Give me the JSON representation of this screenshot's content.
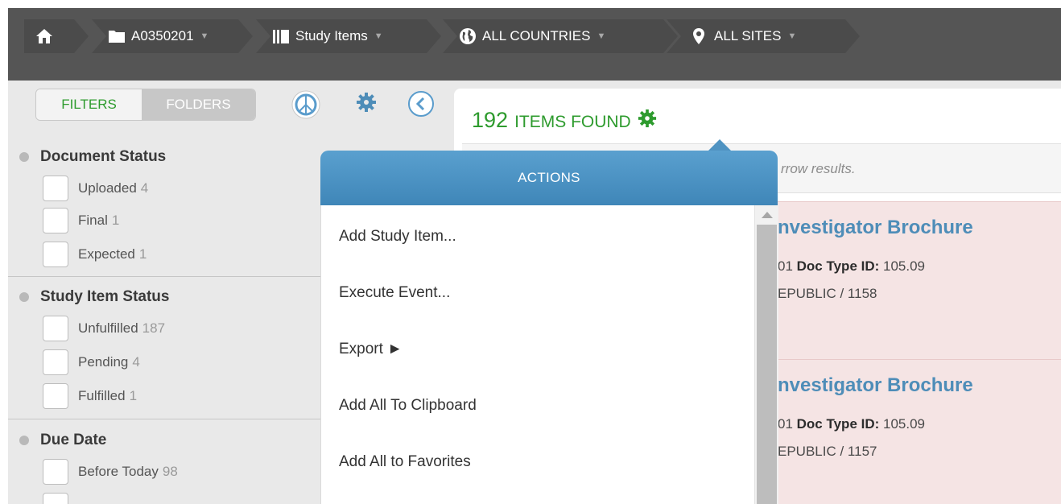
{
  "breadcrumb": {
    "home_icon": "home-icon",
    "study": "A0350201",
    "section": "Study Items",
    "countries": "ALL COUNTRIES",
    "sites": "ALL SITES"
  },
  "sidebar": {
    "tabs": {
      "filters": "FILTERS",
      "folders": "FOLDERS"
    },
    "groups": [
      {
        "title": "Document Status",
        "items": [
          {
            "label": "Uploaded",
            "count": "4"
          },
          {
            "label": "Final",
            "count": "1"
          },
          {
            "label": "Expected",
            "count": "1"
          }
        ]
      },
      {
        "title": "Study Item Status",
        "items": [
          {
            "label": "Unfulfilled",
            "count": "187"
          },
          {
            "label": "Pending",
            "count": "4"
          },
          {
            "label": "Fulfilled",
            "count": "1"
          }
        ]
      },
      {
        "title": "Due Date",
        "items": [
          {
            "label": "Before Today",
            "count": "98"
          }
        ]
      }
    ]
  },
  "main": {
    "count": "192",
    "count_label": "ITEMS FOUND",
    "search_hint": "rrow results.",
    "results": [
      {
        "title": "nvestigator Brochure",
        "line1_prefix": "01 ",
        "line1_key": "Doc Type ID:",
        "line1_value": " 105.09",
        "line2": "EPUBLIC / 1158"
      },
      {
        "title": "nvestigator Brochure",
        "line1_prefix": "01 ",
        "line1_key": "Doc Type ID:",
        "line1_value": " 105.09",
        "line2": "EPUBLIC / 1157"
      }
    ]
  },
  "actions": {
    "title": "ACTIONS",
    "items": [
      "Add Study Item...",
      "Execute Event...",
      "Export ►",
      "Add All To Clipboard",
      "Add All to Favorites"
    ]
  },
  "colors": {
    "accent_green": "#2e9b2e",
    "header_blue": "#4f93c2",
    "breadcrumb_bg": "#4b4b4b",
    "result_bg": "#f5e4e4"
  }
}
